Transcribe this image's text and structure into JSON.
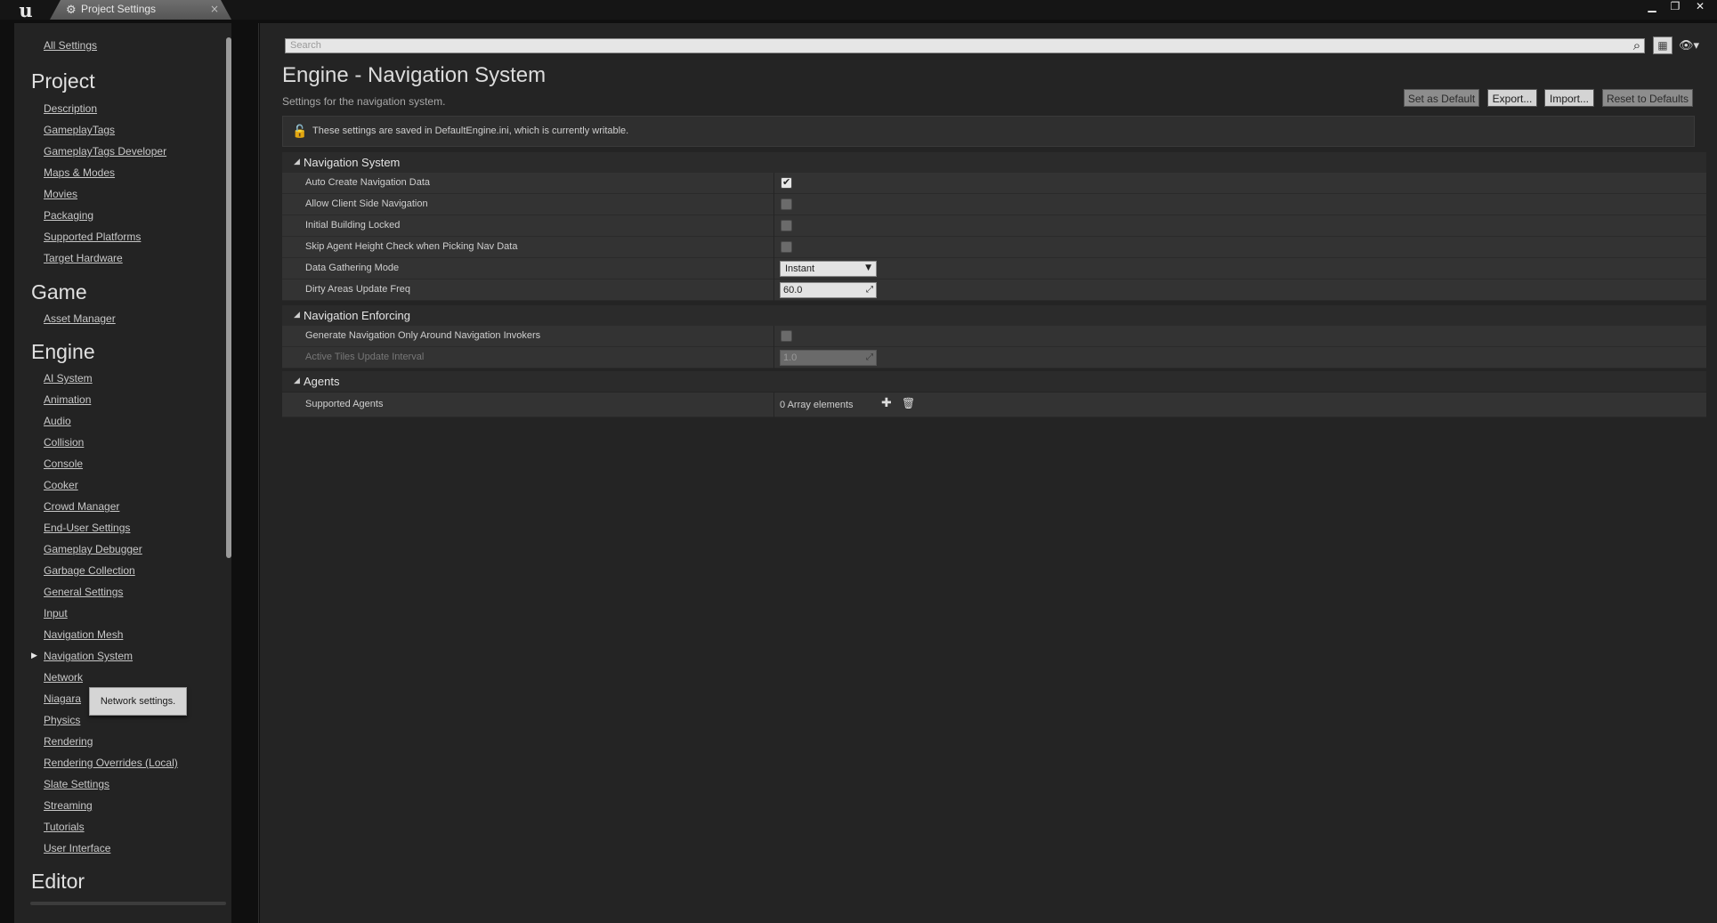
{
  "window": {
    "tab_title": "Project Settings",
    "tab_close": "×",
    "minimize": "▁",
    "restore": "❐",
    "close": "✕"
  },
  "sidebar": {
    "all_settings": "All Settings",
    "categories": [
      {
        "title": "Project",
        "items": [
          "Description",
          "GameplayTags",
          "GameplayTags Developer",
          "Maps & Modes",
          "Movies",
          "Packaging",
          "Supported Platforms",
          "Target Hardware"
        ]
      },
      {
        "title": "Game",
        "items": [
          "Asset Manager"
        ]
      },
      {
        "title": "Engine",
        "items": [
          "AI System",
          "Animation",
          "Audio",
          "Collision",
          "Console",
          "Cooker",
          "Crowd Manager",
          "End-User Settings",
          "Gameplay Debugger",
          "Garbage Collection",
          "General Settings",
          "Input",
          "Navigation Mesh",
          "Navigation System",
          "Network",
          "Niagara",
          "Physics",
          "Rendering",
          "Rendering Overrides (Local)",
          "Slate Settings",
          "Streaming",
          "Tutorials",
          "User Interface"
        ]
      },
      {
        "title": "Editor",
        "items": []
      }
    ],
    "selected_item": "Navigation System",
    "tooltip": "Network settings."
  },
  "search": {
    "placeholder": "Search"
  },
  "page": {
    "title": "Engine - Navigation System",
    "subtitle": "Settings for the navigation system.",
    "buttons": {
      "set_default": "Set as Default",
      "export": "Export...",
      "import": "Import...",
      "reset": "Reset to Defaults"
    },
    "info": "These settings are saved in DefaultEngine.ini, which is currently writable."
  },
  "sections": {
    "nav_system": {
      "title": "Navigation System",
      "auto_create": {
        "label": "Auto Create Navigation Data",
        "checked": true
      },
      "allow_client": {
        "label": "Allow Client Side Navigation",
        "checked": false
      },
      "initial_locked": {
        "label": "Initial Building Locked",
        "checked": false
      },
      "skip_agent": {
        "label": "Skip Agent Height Check when Picking Nav Data",
        "checked": false
      },
      "gathering_mode": {
        "label": "Data Gathering Mode",
        "value": "Instant"
      },
      "dirty_areas": {
        "label": "Dirty Areas Update Freq",
        "value": "60.0"
      }
    },
    "nav_enforcing": {
      "title": "Navigation Enforcing",
      "generate_invokers": {
        "label": "Generate Navigation Only Around Navigation Invokers",
        "checked": false
      },
      "active_tiles": {
        "label": "Active Tiles Update Interval",
        "value": "1.0"
      }
    },
    "agents": {
      "title": "Agents",
      "supported_agents": {
        "label": "Supported Agents",
        "value": "0 Array elements"
      }
    }
  },
  "icons": {
    "logo": "unreal-logo",
    "tab": "gear-icon",
    "search": "search-icon",
    "grid": "grid-view-icon",
    "visibility": "eye-icon",
    "lock": "lock-icon",
    "add": "plus-icon",
    "delete": "trash-icon"
  }
}
